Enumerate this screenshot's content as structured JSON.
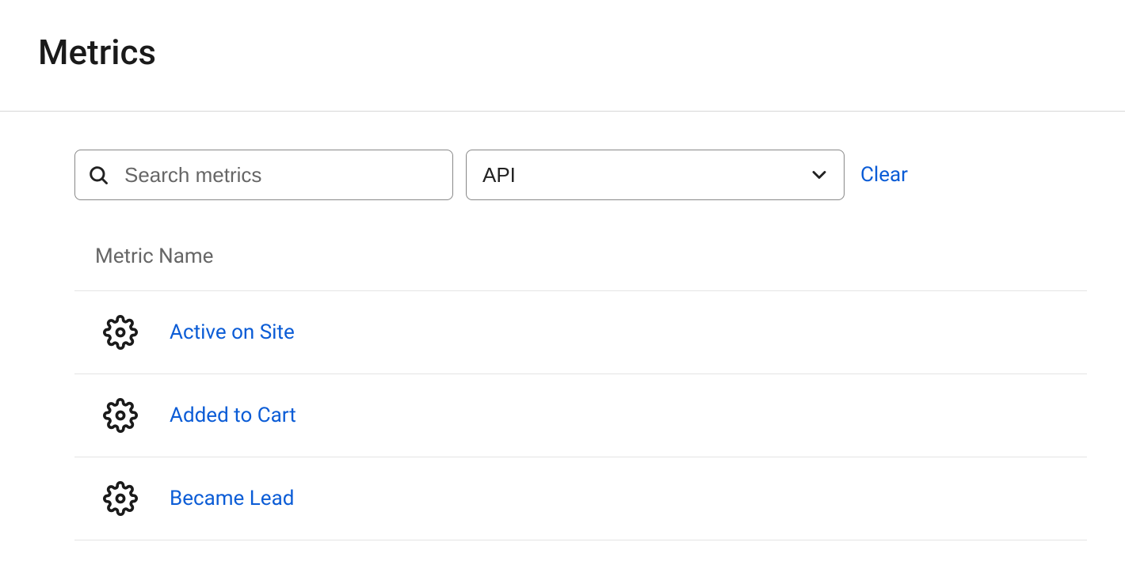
{
  "header": {
    "title": "Metrics"
  },
  "filters": {
    "search_placeholder": "Search metrics",
    "select_value": "API",
    "clear_label": "Clear"
  },
  "table": {
    "column_header": "Metric Name",
    "rows": [
      {
        "name": "Active on Site"
      },
      {
        "name": "Added to Cart"
      },
      {
        "name": "Became Lead"
      }
    ]
  }
}
